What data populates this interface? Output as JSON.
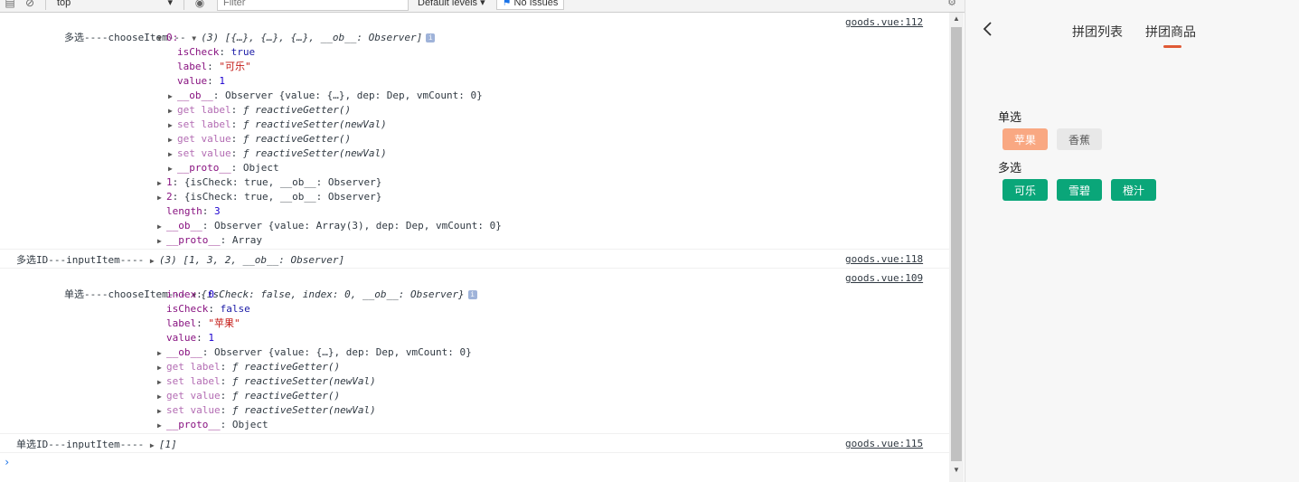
{
  "devtools": {
    "toolbar": {
      "context": "top",
      "filter_placeholder": "Filter",
      "levels": "Default levels ▾",
      "issues": "No Issues"
    },
    "messages": [
      {
        "source": "goods.vue:112",
        "lines": [
          {
            "prefix": "多选----chooseItem--- ",
            "text": "(3) [{…}, {…}, {…}, __ob__: Observer]"
          },
          {
            "text": "0:"
          },
          {
            "key": "isCheck",
            "value": "true"
          },
          {
            "key": "label",
            "value": "\"可乐\""
          },
          {
            "key": "value",
            "value": "1"
          },
          {
            "key": "__ob__",
            "value": "Observer {value: {…}, dep: Dep, vmCount: 0}"
          },
          {
            "key": "get label",
            "value": "ƒ reactiveGetter()"
          },
          {
            "key": "set label",
            "value": "ƒ reactiveSetter(newVal)"
          },
          {
            "key": "get value",
            "value": "ƒ reactiveGetter()"
          },
          {
            "key": "set value",
            "value": "ƒ reactiveSetter(newVal)"
          },
          {
            "key": "__proto__",
            "value": "Object"
          },
          {
            "key": "1",
            "value": "{isCheck: true, __ob__: Observer}"
          },
          {
            "key": "2",
            "value": "{isCheck: true, __ob__: Observer}"
          },
          {
            "key": "length",
            "value": "3"
          },
          {
            "key": "__ob__",
            "value": "Observer {value: Array(3), dep: Dep, vmCount: 0}"
          },
          {
            "key": "__proto__",
            "value": "Array"
          }
        ]
      },
      {
        "source": "goods.vue:118",
        "prefix": "多选ID---inputItem---- ",
        "text": "(3) [1, 3, 2, __ob__: Observer]"
      },
      {
        "source": "goods.vue:109",
        "lines": [
          {
            "prefix": "单选----chooseItem--- ",
            "text": "{isCheck: false, index: 0, __ob__: Observer}"
          },
          {
            "key": "index",
            "value": "0"
          },
          {
            "key": "isCheck",
            "value": "false"
          },
          {
            "key": "label",
            "value": "\"苹果\""
          },
          {
            "key": "value",
            "value": "1"
          },
          {
            "key": "__ob__",
            "value": "Observer {value: {…}, dep: Dep, vmCount: 0}"
          },
          {
            "key": "get label",
            "value": "ƒ reactiveGetter()"
          },
          {
            "key": "set label",
            "value": "ƒ reactiveSetter(newVal)"
          },
          {
            "key": "get value",
            "value": "ƒ reactiveGetter()"
          },
          {
            "key": "set value",
            "value": "ƒ reactiveSetter(newVal)"
          },
          {
            "key": "__proto__",
            "value": "Object"
          }
        ]
      },
      {
        "source": "goods.vue:115",
        "prefix": "单选ID---inputItem---- ",
        "text": "[1]"
      }
    ],
    "prompt": "›"
  },
  "app": {
    "tabs": [
      "拼团列表",
      "拼团商品"
    ],
    "active_tab": 1,
    "single_label": "单选",
    "single_options": [
      "苹果",
      "香蕉"
    ],
    "multi_label": "多选",
    "multi_options": [
      "可乐",
      "雪碧",
      "橙汁"
    ],
    "colors": {
      "selected_single": "#f9a882",
      "unselected_single": "#e8e8e8",
      "selected_multi": "#0aa679",
      "tab_underline": "#e05a36"
    }
  }
}
